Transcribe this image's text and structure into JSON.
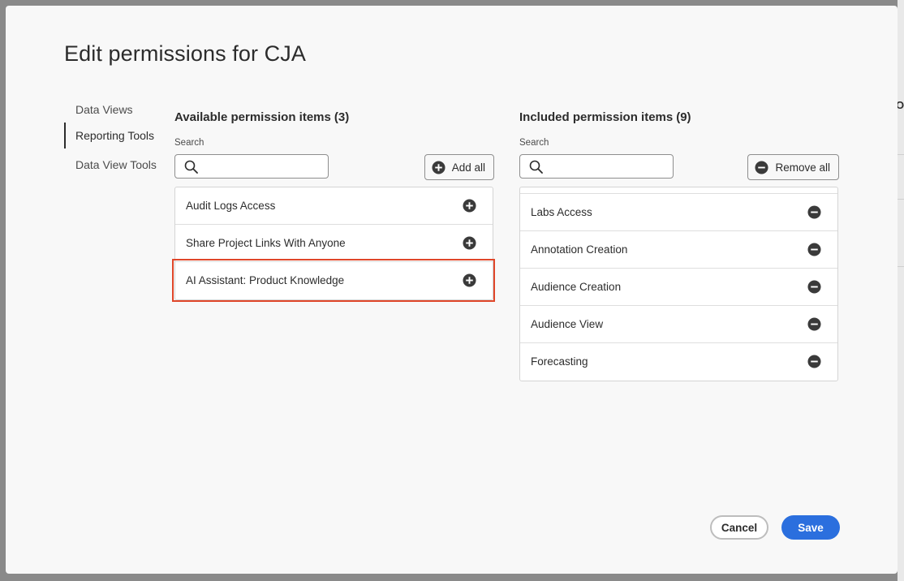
{
  "dialog": {
    "title": "Edit permissions for CJA"
  },
  "sidebar": {
    "items": [
      {
        "label": "Data Views",
        "active": false
      },
      {
        "label": "Reporting Tools",
        "active": true
      },
      {
        "label": "Data View Tools",
        "active": false
      }
    ]
  },
  "available": {
    "heading": "Available permission items",
    "count": "(3)",
    "search_label": "Search",
    "search_value": "",
    "add_all_label": "Add all",
    "items": [
      {
        "label": "Audit Logs Access",
        "action_icon": "plus-circle-icon"
      },
      {
        "label": "Share Project Links With Anyone",
        "action_icon": "plus-circle-icon"
      },
      {
        "label": "AI Assistant: Product Knowledge",
        "action_icon": "plus-circle-icon",
        "highlighted": true
      }
    ]
  },
  "included": {
    "heading": "Included permission items",
    "count": "(9)",
    "search_label": "Search",
    "search_value": "",
    "remove_all_label": "Remove all",
    "items": [
      {
        "label": "Labs Access",
        "action_icon": "minus-circle-icon"
      },
      {
        "label": "Annotation Creation",
        "action_icon": "minus-circle-icon"
      },
      {
        "label": "Audience Creation",
        "action_icon": "minus-circle-icon"
      },
      {
        "label": "Audience View",
        "action_icon": "minus-circle-icon"
      },
      {
        "label": "Forecasting",
        "action_icon": "minus-circle-icon"
      }
    ]
  },
  "footer": {
    "cancel_label": "Cancel",
    "save_label": "Save"
  },
  "background": {
    "peek_text": "Op"
  },
  "colors": {
    "accent": "#2b6fde",
    "highlight_border": "#e0472a",
    "icon_fill": "#3a3a3a"
  }
}
